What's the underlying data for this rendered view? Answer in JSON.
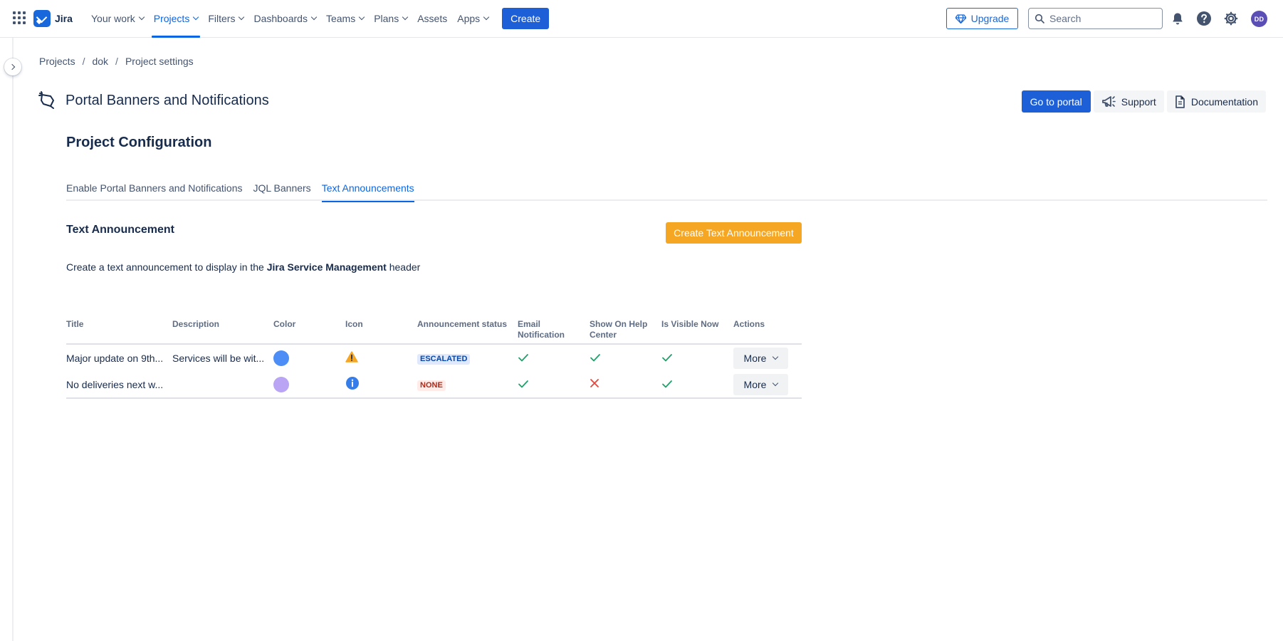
{
  "topnav": {
    "logo_text": "Jira",
    "items": [
      {
        "label": "Your work",
        "has_chevron": true
      },
      {
        "label": "Projects",
        "has_chevron": true,
        "active": true
      },
      {
        "label": "Filters",
        "has_chevron": true
      },
      {
        "label": "Dashboards",
        "has_chevron": true
      },
      {
        "label": "Teams",
        "has_chevron": true
      },
      {
        "label": "Plans",
        "has_chevron": true
      },
      {
        "label": "Assets",
        "has_chevron": false
      },
      {
        "label": "Apps",
        "has_chevron": true
      }
    ],
    "create_label": "Create",
    "upgrade_label": "Upgrade",
    "search_placeholder": "Search",
    "avatar_initials": "DD",
    "colors": {
      "primary": "#1d5fd6",
      "active": "#0c66e4",
      "avatar": "#5b4eb4"
    }
  },
  "breadcrumb": [
    "Projects",
    "dok",
    "Project settings"
  ],
  "header": {
    "title": "Portal Banners and Notifications",
    "go_to_portal_label": "Go to portal",
    "support_label": "Support",
    "documentation_label": "Documentation"
  },
  "section_title": "Project Configuration",
  "tabs": [
    {
      "label": "Enable Portal Banners and Notifications",
      "active": false
    },
    {
      "label": "JQL Banners",
      "active": false
    },
    {
      "label": "Text Announcements",
      "active": true
    }
  ],
  "content": {
    "heading": "Text Announcement",
    "create_button_label": "Create Text Announcement",
    "create_button_color": "#f5a623",
    "description_prefix": "Create a text announcement to display in the ",
    "description_bold": "Jira Service Management",
    "description_suffix": " header"
  },
  "table": {
    "columns": [
      "Title",
      "Description",
      "Color",
      "Icon",
      "Announcement status",
      "Email Notification",
      "Show On Help Center",
      "Is Visible Now",
      "Actions"
    ],
    "rows": [
      {
        "title": "Major update on 9th...",
        "description": "Services will be wit...",
        "color": "#4c8df6",
        "icon": "warning-icon",
        "status": "ESCALATED",
        "status_bg": "#dfe8fd",
        "status_fg": "#0747a6",
        "email_notification": true,
        "show_on_help_center": true,
        "is_visible_now": true,
        "action_label": "More"
      },
      {
        "title": "No deliveries next w...",
        "description": "",
        "color": "#b9a5f4",
        "icon": "info-icon",
        "status": "NONE",
        "status_bg": "#ffece8",
        "status_fg": "#ae2a19",
        "email_notification": true,
        "show_on_help_center": false,
        "is_visible_now": true,
        "action_label": "More"
      }
    ]
  }
}
